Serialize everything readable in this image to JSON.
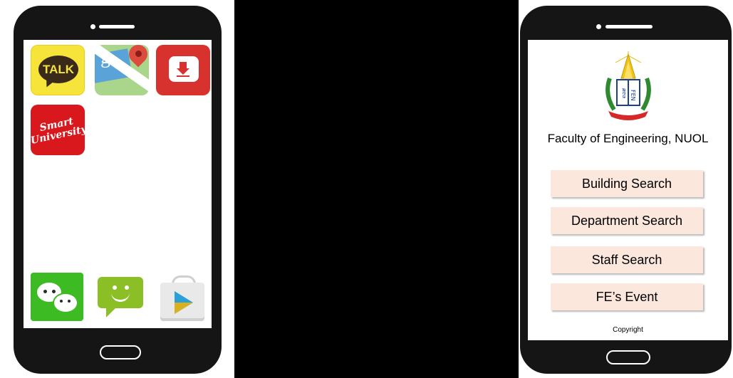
{
  "left_phone": {
    "apps_top": [
      {
        "name": "KakaoTalk",
        "label": "TALK"
      },
      {
        "name": "Google Maps",
        "label": "g"
      },
      {
        "name": "Video Downloader"
      },
      {
        "name": "Smart University",
        "label": "Smart University"
      }
    ],
    "dock_apps": [
      {
        "name": "WeChat"
      },
      {
        "name": "Messaging"
      },
      {
        "name": "Play Store"
      }
    ]
  },
  "right_phone": {
    "faculty_title": "Faculty of Engineering, NUOL",
    "logo": {
      "left_text": "ຄວສ",
      "right_text": "FEN"
    },
    "menu": [
      {
        "label": "Building Search"
      },
      {
        "label": "Department Search"
      },
      {
        "label": "Staff Search"
      },
      {
        "label": "FE’s Event"
      }
    ],
    "copyright": "Copyright"
  },
  "colors": {
    "phone_body": "#151515",
    "button_bg": "#fbe7dc",
    "talk_yellow": "#f7e43a",
    "smart_red": "#d9181d"
  }
}
